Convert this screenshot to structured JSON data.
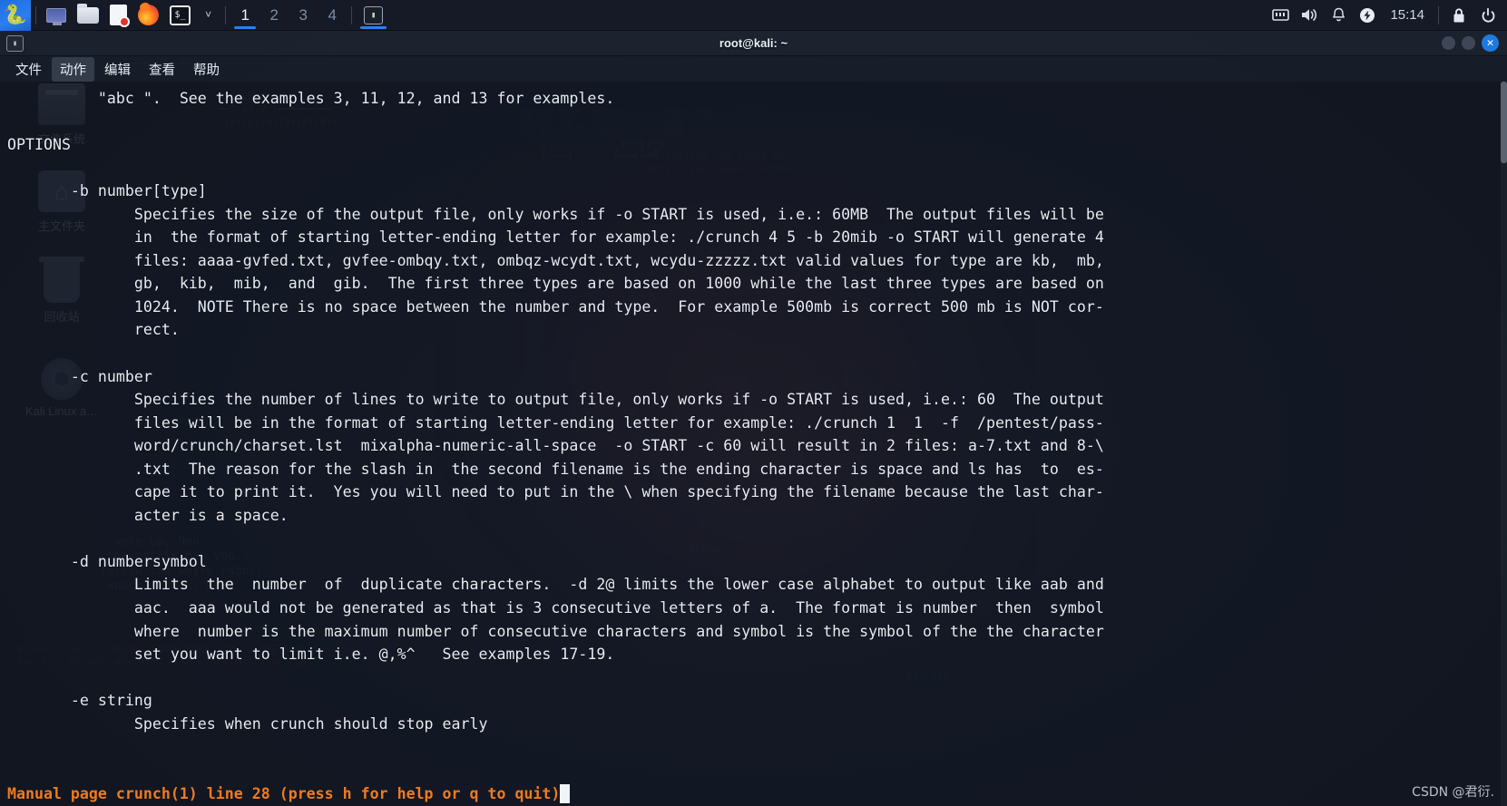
{
  "panel": {
    "kali_logo": "kali-dragon-icon",
    "launchers": [
      {
        "name": "show-desktop",
        "icon": "monitor-icon"
      },
      {
        "name": "file-manager",
        "icon": "folder-icon"
      },
      {
        "name": "text-editor",
        "icon": "document-icon"
      },
      {
        "name": "firefox",
        "icon": "firefox-icon"
      },
      {
        "name": "terminal",
        "icon": "terminal-icon",
        "label": "$_"
      }
    ],
    "chevron": "˅",
    "workspaces": [
      "1",
      "2",
      "3",
      "4"
    ],
    "active_workspace": "1",
    "task_window_icon": "terminal-icon",
    "tray": {
      "network": "network-icon",
      "volume": "volume-icon",
      "notifications": "bell-icon",
      "power": "power-icon",
      "clock": "15:14",
      "lock": "lock-icon",
      "logout": "logout-icon"
    }
  },
  "window": {
    "title": "root@kali: ~",
    "icon": "terminal-icon",
    "controls": {
      "minimize": "minimize-button",
      "maximize": "maximize-button",
      "close": "✕"
    },
    "menus": [
      {
        "label": "文件",
        "name": "menu-file"
      },
      {
        "label": "动作",
        "name": "menu-actions",
        "hover": true
      },
      {
        "label": "编辑",
        "name": "menu-edit"
      },
      {
        "label": "查看",
        "name": "menu-view"
      },
      {
        "label": "帮助",
        "name": "menu-help"
      }
    ]
  },
  "terminal": {
    "content": "          \"abc \".  See the examples 3, 11, 12, and 13 for examples.\n\nOPTIONS\n\n       -b number[type]\n              Specifies the size of the output file, only works if -o START is used, i.e.: 60MB  The output files will be\n              in  the format of starting letter-ending letter for example: ./crunch 4 5 -b 20mib -o START will generate 4\n              files: aaaa-gvfed.txt, gvfee-ombqy.txt, ombqz-wcydt.txt, wcydu-zzzzz.txt valid values for type are kb,  mb,\n              gb,  kib,  mib,  and  gib.  The first three types are based on 1000 while the last three types are based on\n              1024.  NOTE There is no space between the number and type.  For example 500mb is correct 500 mb is NOT cor-\n              rect.\n\n       -c number\n              Specifies the number of lines to write to output file, only works if -o START is used, i.e.: 60  The output\n              files will be in the format of starting letter-ending letter for example: ./crunch 1  1  -f  /pentest/pass-\n              word/crunch/charset.lst  mixalpha-numeric-all-space  -o START -c 60 will result in 2 files: a-7.txt and 8-\\\n              .txt  The reason for the slash in  the second filename is the ending character is space and ls has  to  es-\n              cape it to print it.  Yes you will need to put in the \\ when specifying the filename because the last char-\n              acter is a space.\n\n       -d numbersymbol\n              Limits  the  number  of  duplicate characters.  -d 2@ limits the lower case alphabet to output like aab and\n              aac.  aaa would not be generated as that is 3 consecutive letters of a.  The format is number  then  symbol\n              where  number is the maximum number of consecutive characters and symbol is the symbol of the the character\n              set you want to limit i.e. @,%^   See examples 17-19.\n\n       -e string\n              Specifies when crunch should stop early",
    "status_line": "Manual page crunch(1) line 28 (press h for help or q to quit)",
    "status_color": "#f07a1f",
    "cursor": "block-cursor"
  },
  "desktop": {
    "icons": [
      {
        "label": "文件系统",
        "name": "desktop-icon-filesystem",
        "glyph": "drive"
      },
      {
        "label": "主文件夹",
        "name": "desktop-icon-home",
        "glyph": "home"
      },
      {
        "label": "回收站",
        "name": "desktop-icon-trash",
        "glyph": "trash"
      },
      {
        "label": "Kali Linux a…",
        "name": "desktop-icon-kali-disc",
        "glyph": "disc"
      }
    ]
  },
  "watermark": "CSDN @君衍."
}
